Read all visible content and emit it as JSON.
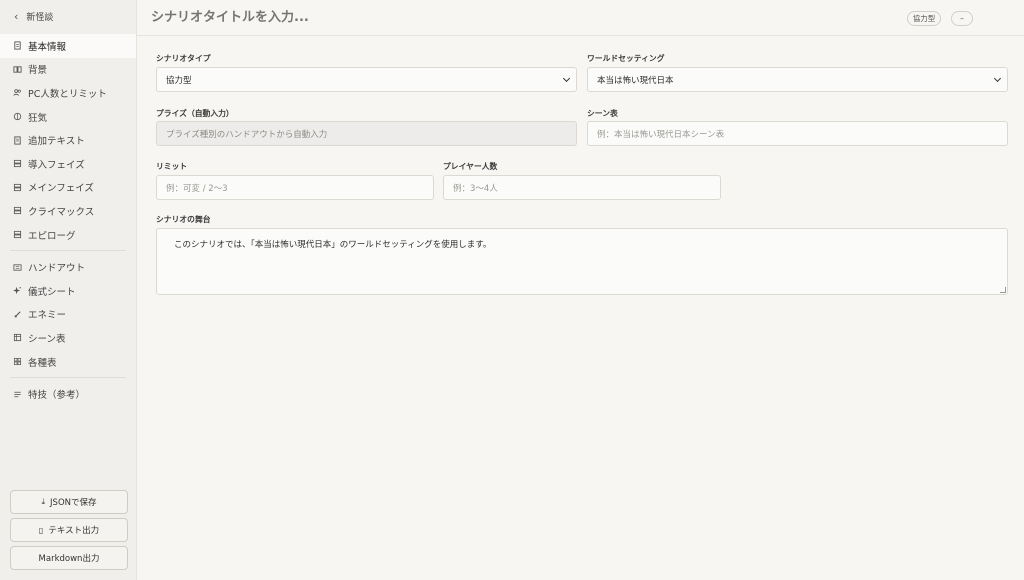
{
  "sidebar": {
    "back_label": "新怪談",
    "items": [
      {
        "label": "基本情報",
        "icon": "document-icon"
      },
      {
        "label": "背景",
        "icon": "book-icon"
      },
      {
        "label": "PC人数とリミット",
        "icon": "users-icon"
      },
      {
        "label": "狂気",
        "icon": "brain-icon"
      },
      {
        "label": "追加テキスト",
        "icon": "file-text-icon"
      },
      {
        "label": "導入フェイズ",
        "icon": "layers-icon"
      },
      {
        "label": "メインフェイズ",
        "icon": "layers-icon"
      },
      {
        "label": "クライマックス",
        "icon": "layers-icon"
      },
      {
        "label": "エピローグ",
        "icon": "layers-icon"
      }
    ],
    "items2": [
      {
        "label": "ハンドアウト",
        "icon": "id-card-icon"
      },
      {
        "label": "儀式シート",
        "icon": "sparkles-icon"
      },
      {
        "label": "エネミー",
        "icon": "sword-icon"
      },
      {
        "label": "シーン表",
        "icon": "table-icon"
      },
      {
        "label": "各種表",
        "icon": "grid-icon"
      }
    ],
    "items3": [
      {
        "label": "特技（参考）",
        "icon": "list-icon"
      }
    ],
    "buttons": {
      "save_json": "JSONで保存",
      "export_text": "テキスト出力",
      "export_markdown": "Markdown出力"
    }
  },
  "header": {
    "title_placeholder": "シナリオタイトルを入力...",
    "type_badge": "協力型",
    "dash_badge": "–"
  },
  "form": {
    "scenario_type": {
      "label": "シナリオタイプ",
      "value": "協力型"
    },
    "world_setting": {
      "label": "ワールドセッティング",
      "value": "本当は怖い現代日本"
    },
    "prize": {
      "label": "プライズ（自動入力）",
      "placeholder": "プライズ種別のハンドアウトから自動入力"
    },
    "scene_table": {
      "label": "シーン表",
      "placeholder": "例：本当は怖い現代日本シーン表"
    },
    "limit": {
      "label": "リミット",
      "placeholder": "例：可変 / 2〜3"
    },
    "players": {
      "label": "プレイヤー人数",
      "placeholder": "例：3〜4人"
    },
    "stage": {
      "label": "シナリオの舞台",
      "value": "このシナリオでは、「本当は怖い現代日本」のワールドセッティングを使用します。"
    }
  }
}
